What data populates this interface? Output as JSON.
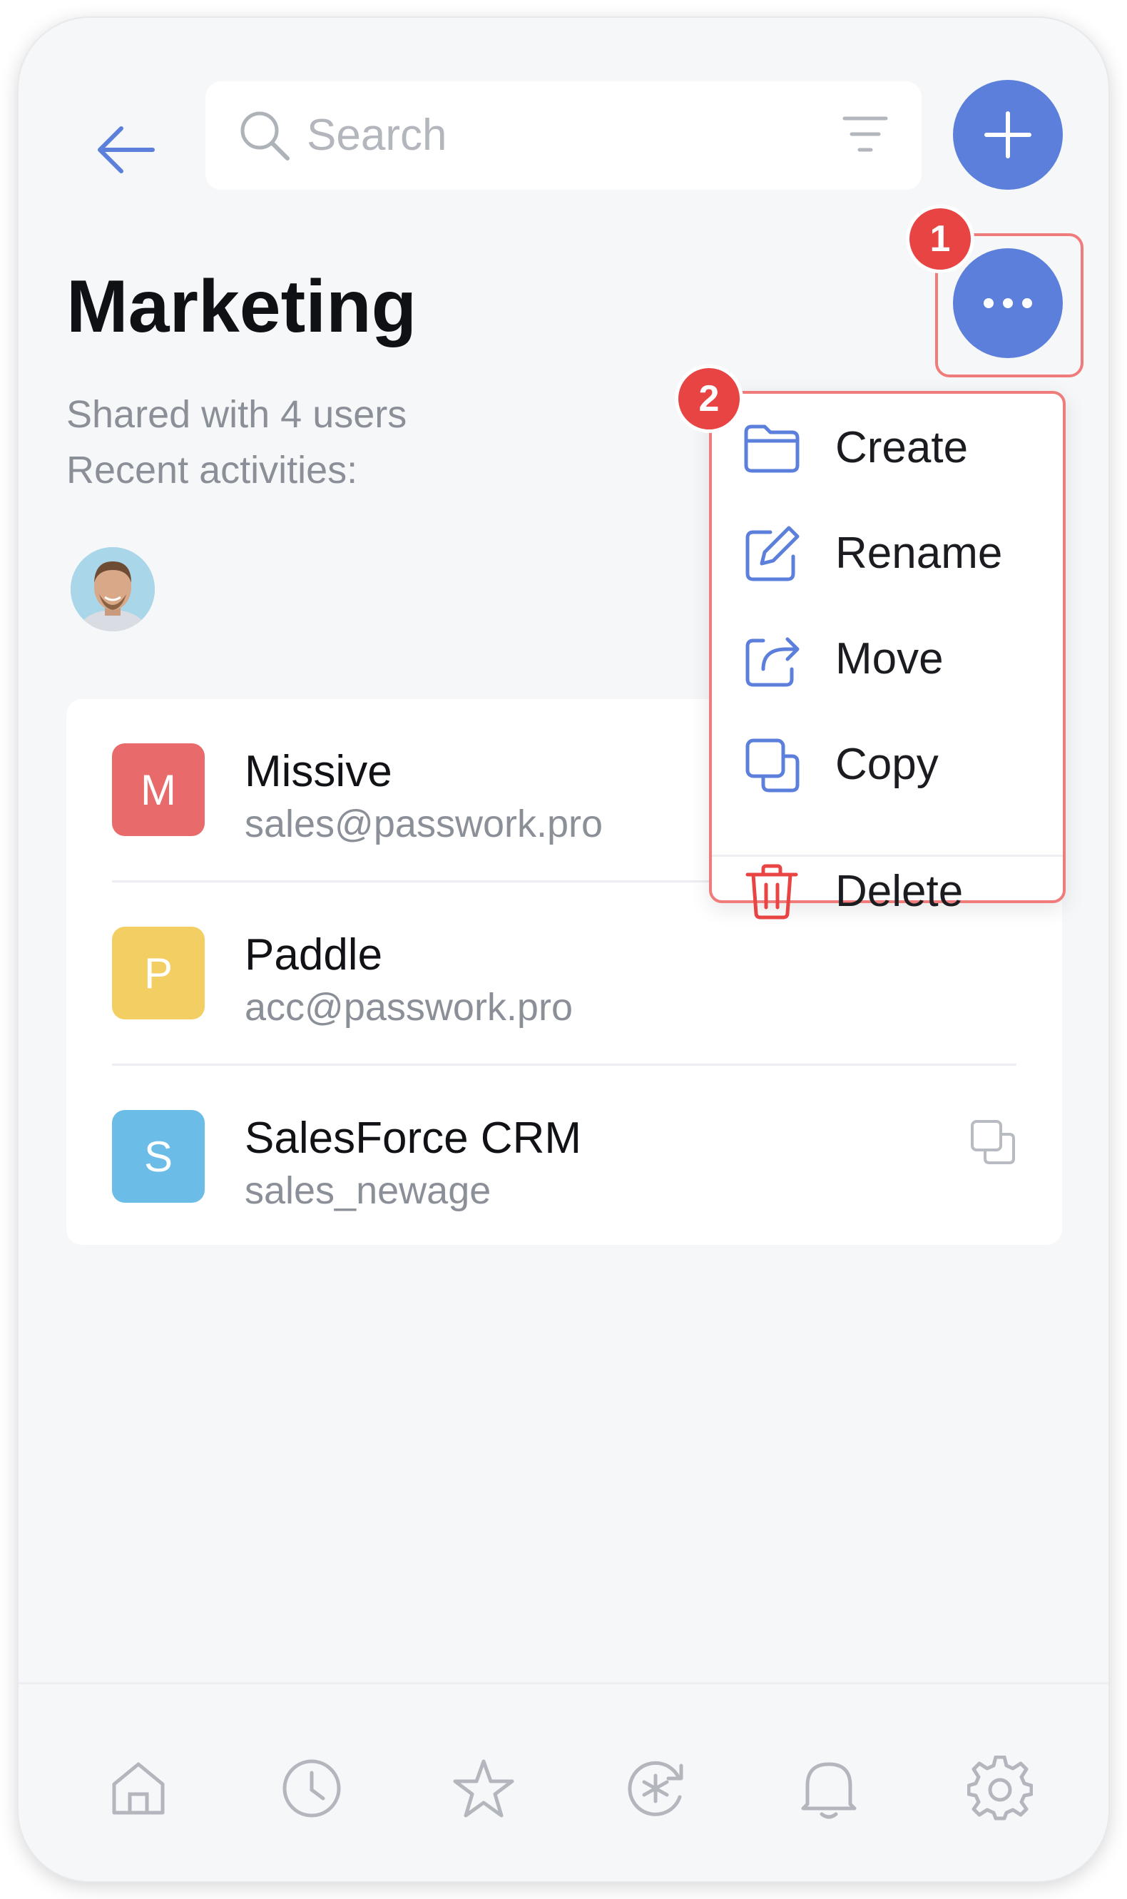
{
  "search": {
    "placeholder": "Search"
  },
  "folder": {
    "title": "Marketing",
    "shared_text": "Shared with 4 users",
    "recent_label": "Recent activities:"
  },
  "annotations": {
    "badge_1": "1",
    "badge_2": "2"
  },
  "entries": [
    {
      "initial": "M",
      "name": "Missive",
      "login": "sales@passwork.pro",
      "color": "#e96a6a"
    },
    {
      "initial": "P",
      "name": "Paddle",
      "login": "acc@passwork.pro",
      "color": "#f3cf63"
    },
    {
      "initial": "S",
      "name": "SalesForce CRM",
      "login": "sales_newage",
      "color": "#6bbde8"
    }
  ],
  "menu": {
    "items": [
      {
        "label": "Create",
        "icon": "folder-icon"
      },
      {
        "label": "Rename",
        "icon": "edit-icon"
      },
      {
        "label": "Move",
        "icon": "move-icon"
      },
      {
        "label": "Copy",
        "icon": "copy-icon"
      },
      {
        "label": "Delete",
        "icon": "trash-icon"
      }
    ]
  },
  "bottom_nav": [
    "home-icon",
    "history-icon",
    "star-icon",
    "password-generator-icon",
    "bell-icon",
    "gear-icon"
  ],
  "colors": {
    "accent": "#5b7fdb",
    "highlight": "#ef7b7b",
    "badge": "#e84444",
    "danger": "#e84444"
  }
}
